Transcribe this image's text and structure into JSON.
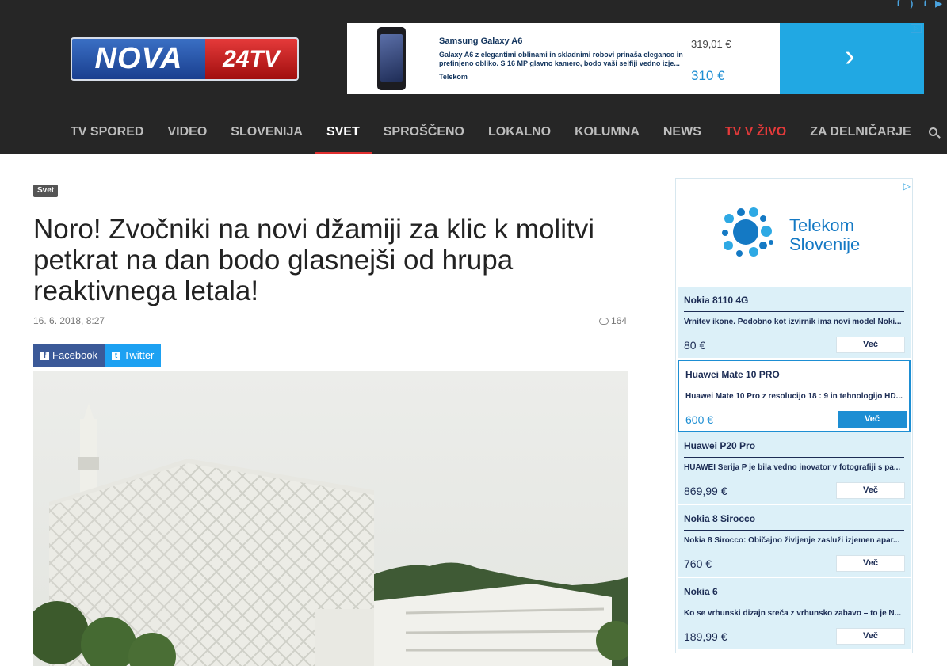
{
  "header": {
    "logo_main": "NOVA",
    "logo_accent": "24TV",
    "social_icons": [
      "facebook-icon",
      "rss-icon",
      "twitter-icon",
      "youtube-icon"
    ]
  },
  "top_ad": {
    "product": "Samsung Galaxy A6",
    "description": "Galaxy A6 z elegantimi oblinami in skladnimi robovi prinaša eleganco in prefinjeno obliko. S 16 MP glavno kamero, bodo vaši selfiji vedno izje...",
    "brand": "Telekom",
    "old_price": "319,01 €",
    "new_price": "310 €"
  },
  "nav": {
    "items": [
      "TV SPORED",
      "VIDEO",
      "SLOVENIJA",
      "SVET",
      "SPROŠČENO",
      "LOKALNO",
      "KOLUMNA",
      "NEWS",
      "TV V ŽIVO",
      "ZA DELNIČARJE"
    ],
    "active": "SVET",
    "live": "TV V ŽIVO"
  },
  "article": {
    "category": "Svet",
    "title": "Noro! Zvočniki na novi džamiji za klic k molitvi petkrat na dan bodo glasnejši od hrupa reaktivnega letala!",
    "date": "16. 6. 2018, 8:27",
    "comments": "164",
    "share_facebook": "Facebook",
    "share_twitter": "Twitter"
  },
  "side_ad": {
    "brand_line1": "Telekom",
    "brand_line2": "Slovenije",
    "products": [
      {
        "name": "Nokia 8110 4G",
        "desc": "Vrnitev ikone. Podobno kot izvirnik ima novi model Noki...",
        "price": "80 €",
        "button": "Več"
      },
      {
        "name": "Huawei Mate 10 PRO",
        "desc": "Huawei Mate 10 Pro z resolucijo 18 : 9 in tehnologijo HD...",
        "price": "600 €",
        "button": "Več"
      },
      {
        "name": "Huawei P20 Pro",
        "desc": "HUAWEI Serija P je bila vedno inovator v fotografiji s pa...",
        "price": "869,99 €",
        "button": "Več"
      },
      {
        "name": "Nokia 8 Sirocco",
        "desc": "Nokia 8 Sirocco: Običajno življenje zasluži izjemen apar...",
        "price": "760 €",
        "button": "Več"
      },
      {
        "name": "Nokia 6",
        "desc": "Ko se vrhunski dizajn sreča z vrhunsko zabavo – to je N...",
        "price": "189,99 €",
        "button": "Več"
      }
    ]
  }
}
